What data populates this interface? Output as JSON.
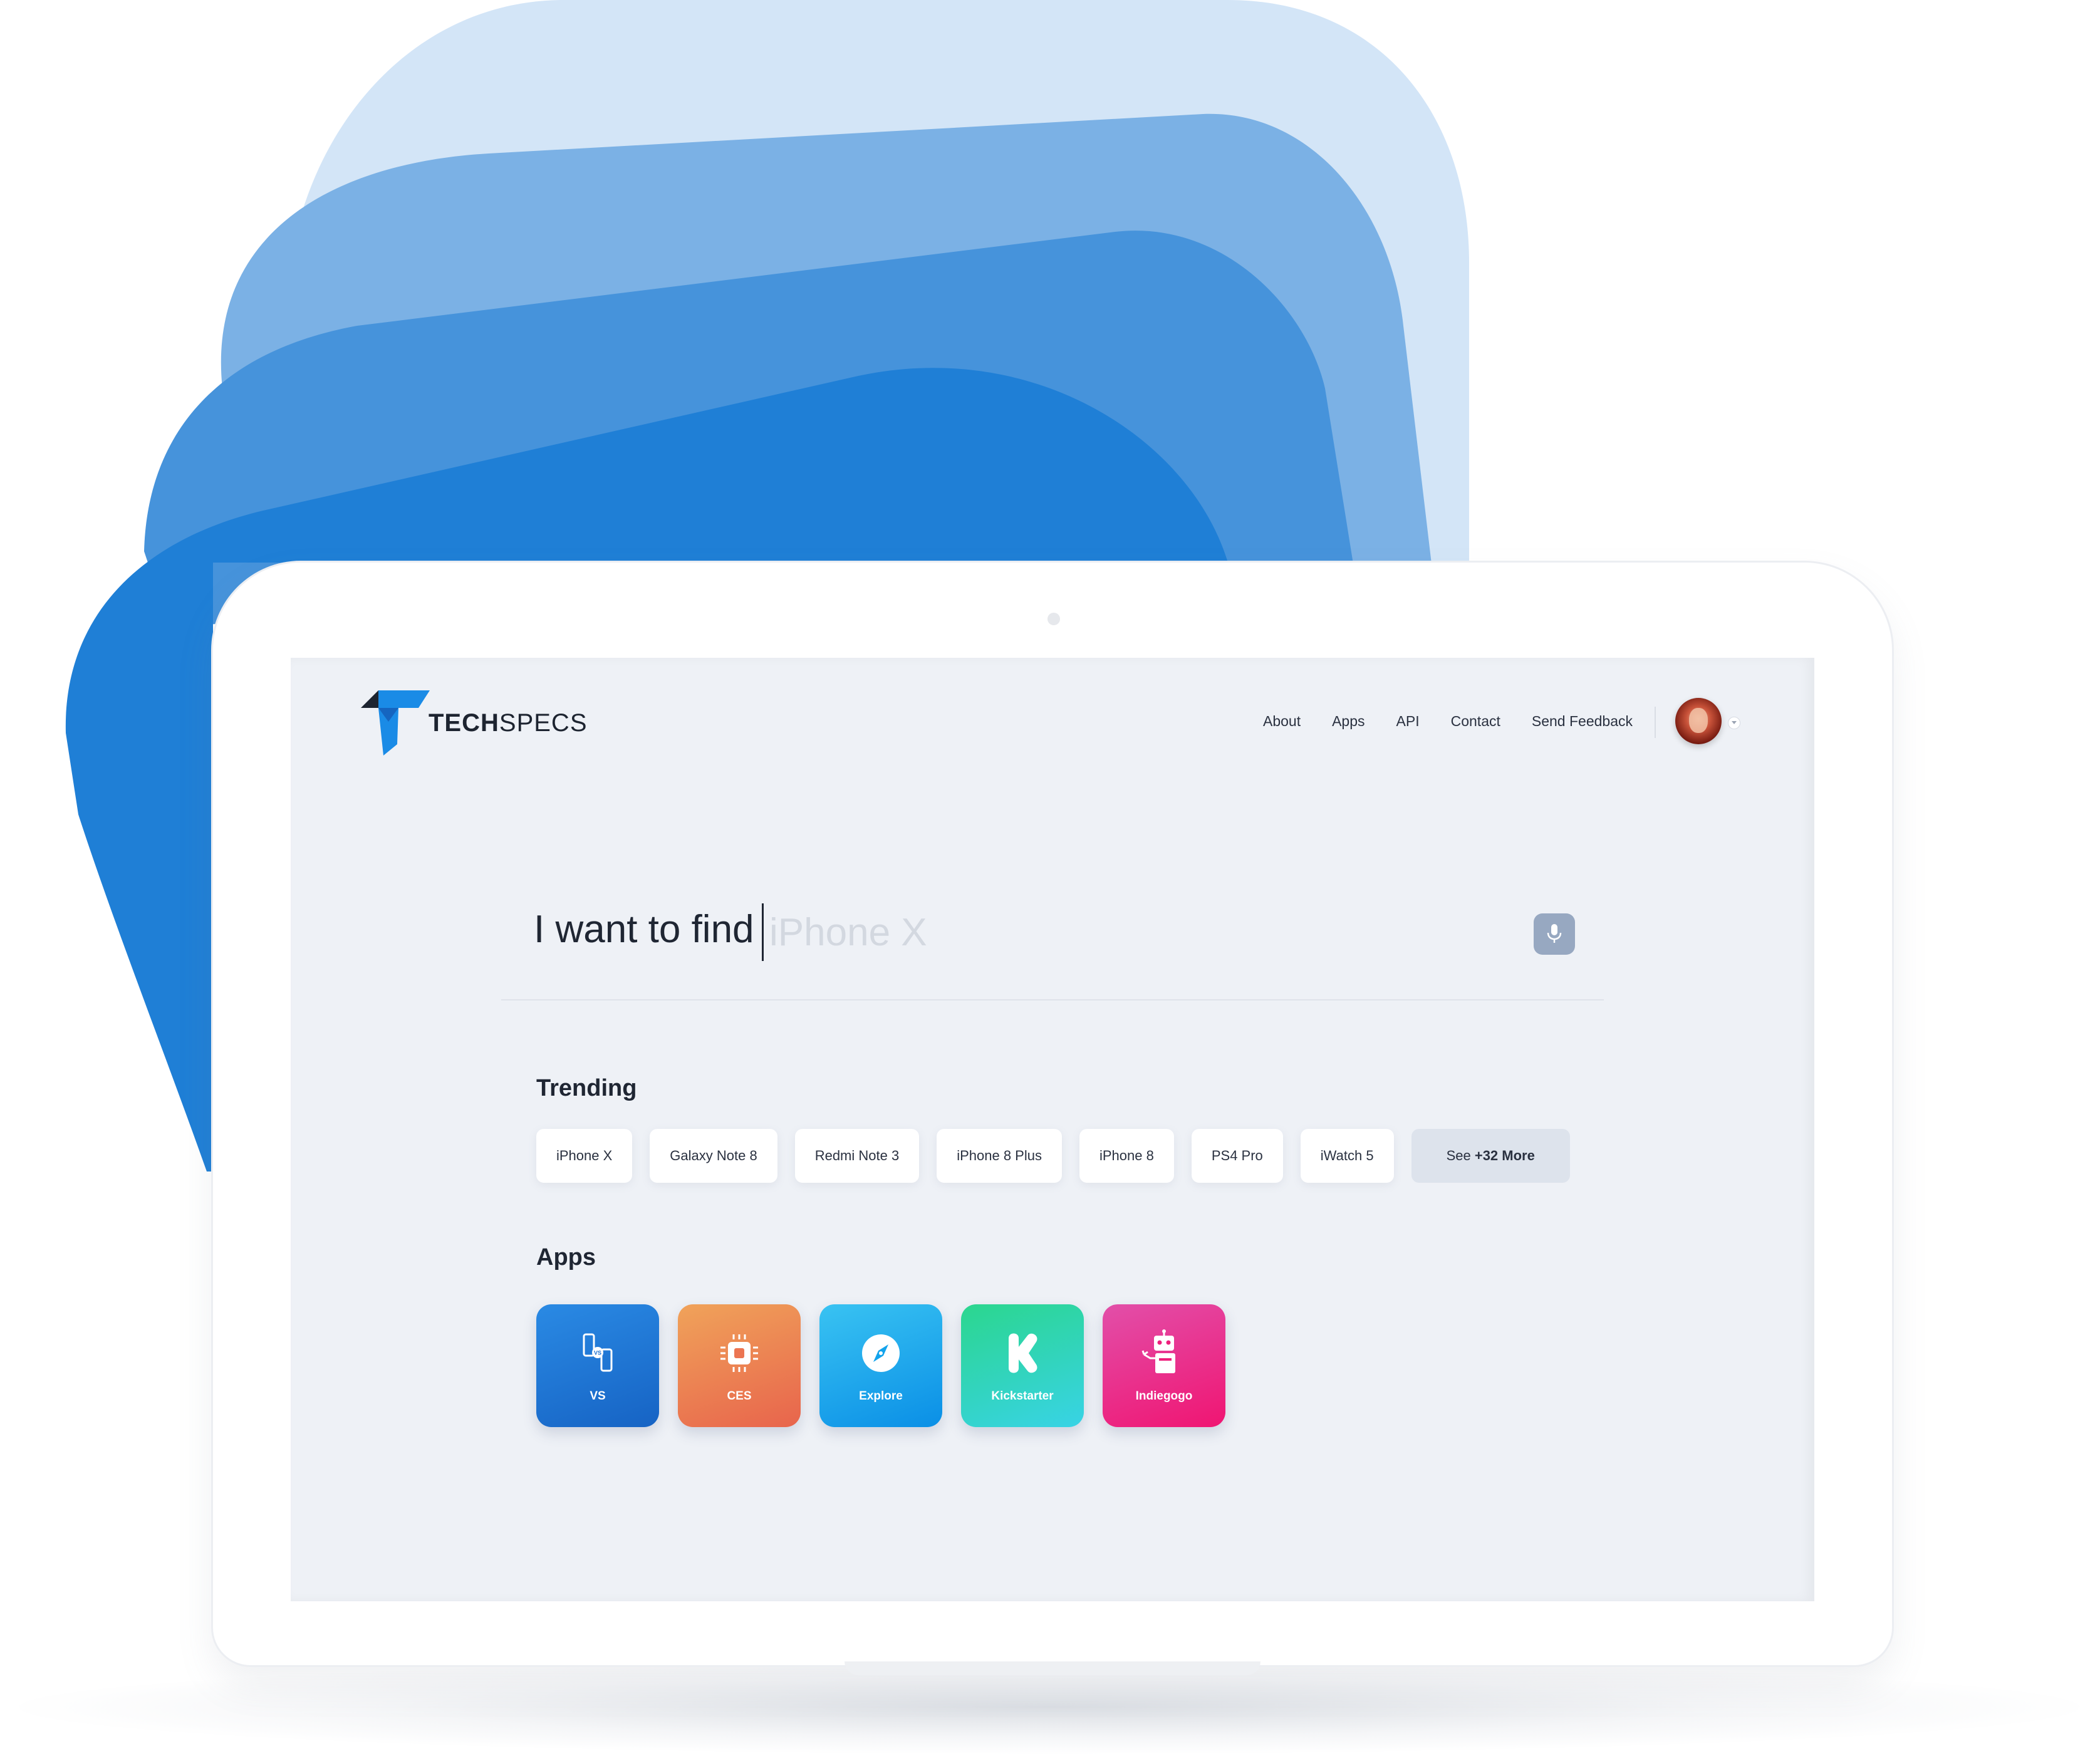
{
  "brand": {
    "name_bold": "TECH",
    "name_light": "SPECS"
  },
  "nav": {
    "items": [
      "About",
      "Apps",
      "API",
      "Contact",
      "Send Feedback"
    ]
  },
  "search": {
    "prefix": "I want to find",
    "placeholder": "iPhone X"
  },
  "trending": {
    "title": "Trending",
    "chips": [
      "iPhone X",
      "Galaxy Note 8",
      "Redmi Note 3",
      "iPhone 8 Plus",
      "iPhone 8",
      "PS4 Pro",
      "iWatch 5"
    ],
    "more_prefix": "See ",
    "more_bold": "+32 More"
  },
  "apps": {
    "title": "Apps",
    "items": [
      {
        "label": "VS",
        "icon": "versus-phone-icon"
      },
      {
        "label": "CES",
        "icon": "chip-icon"
      },
      {
        "label": "Explore",
        "icon": "compass-icon"
      },
      {
        "label": "Kickstarter",
        "icon": "kickstarter-k-icon"
      },
      {
        "label": "Indiegogo",
        "icon": "robot-icon"
      }
    ]
  },
  "colors": {
    "shape_light": "#d3e5f7",
    "shape_mid_light": "#7bb1e5",
    "shape_mid": "#4693db",
    "shape_dark": "#1f7fd6",
    "screen_bg": "#eef1f6",
    "mic_button": "#97a8c1",
    "logo_black": "#1d2430",
    "logo_blue": "#1a8be6",
    "app_vs": "#1a6fd1",
    "app_ces": "#ec7552",
    "app_explore": "#12a3ec",
    "app_kickstarter": "#2ed2c8",
    "app_indiegogo": "#ee1f7c"
  }
}
